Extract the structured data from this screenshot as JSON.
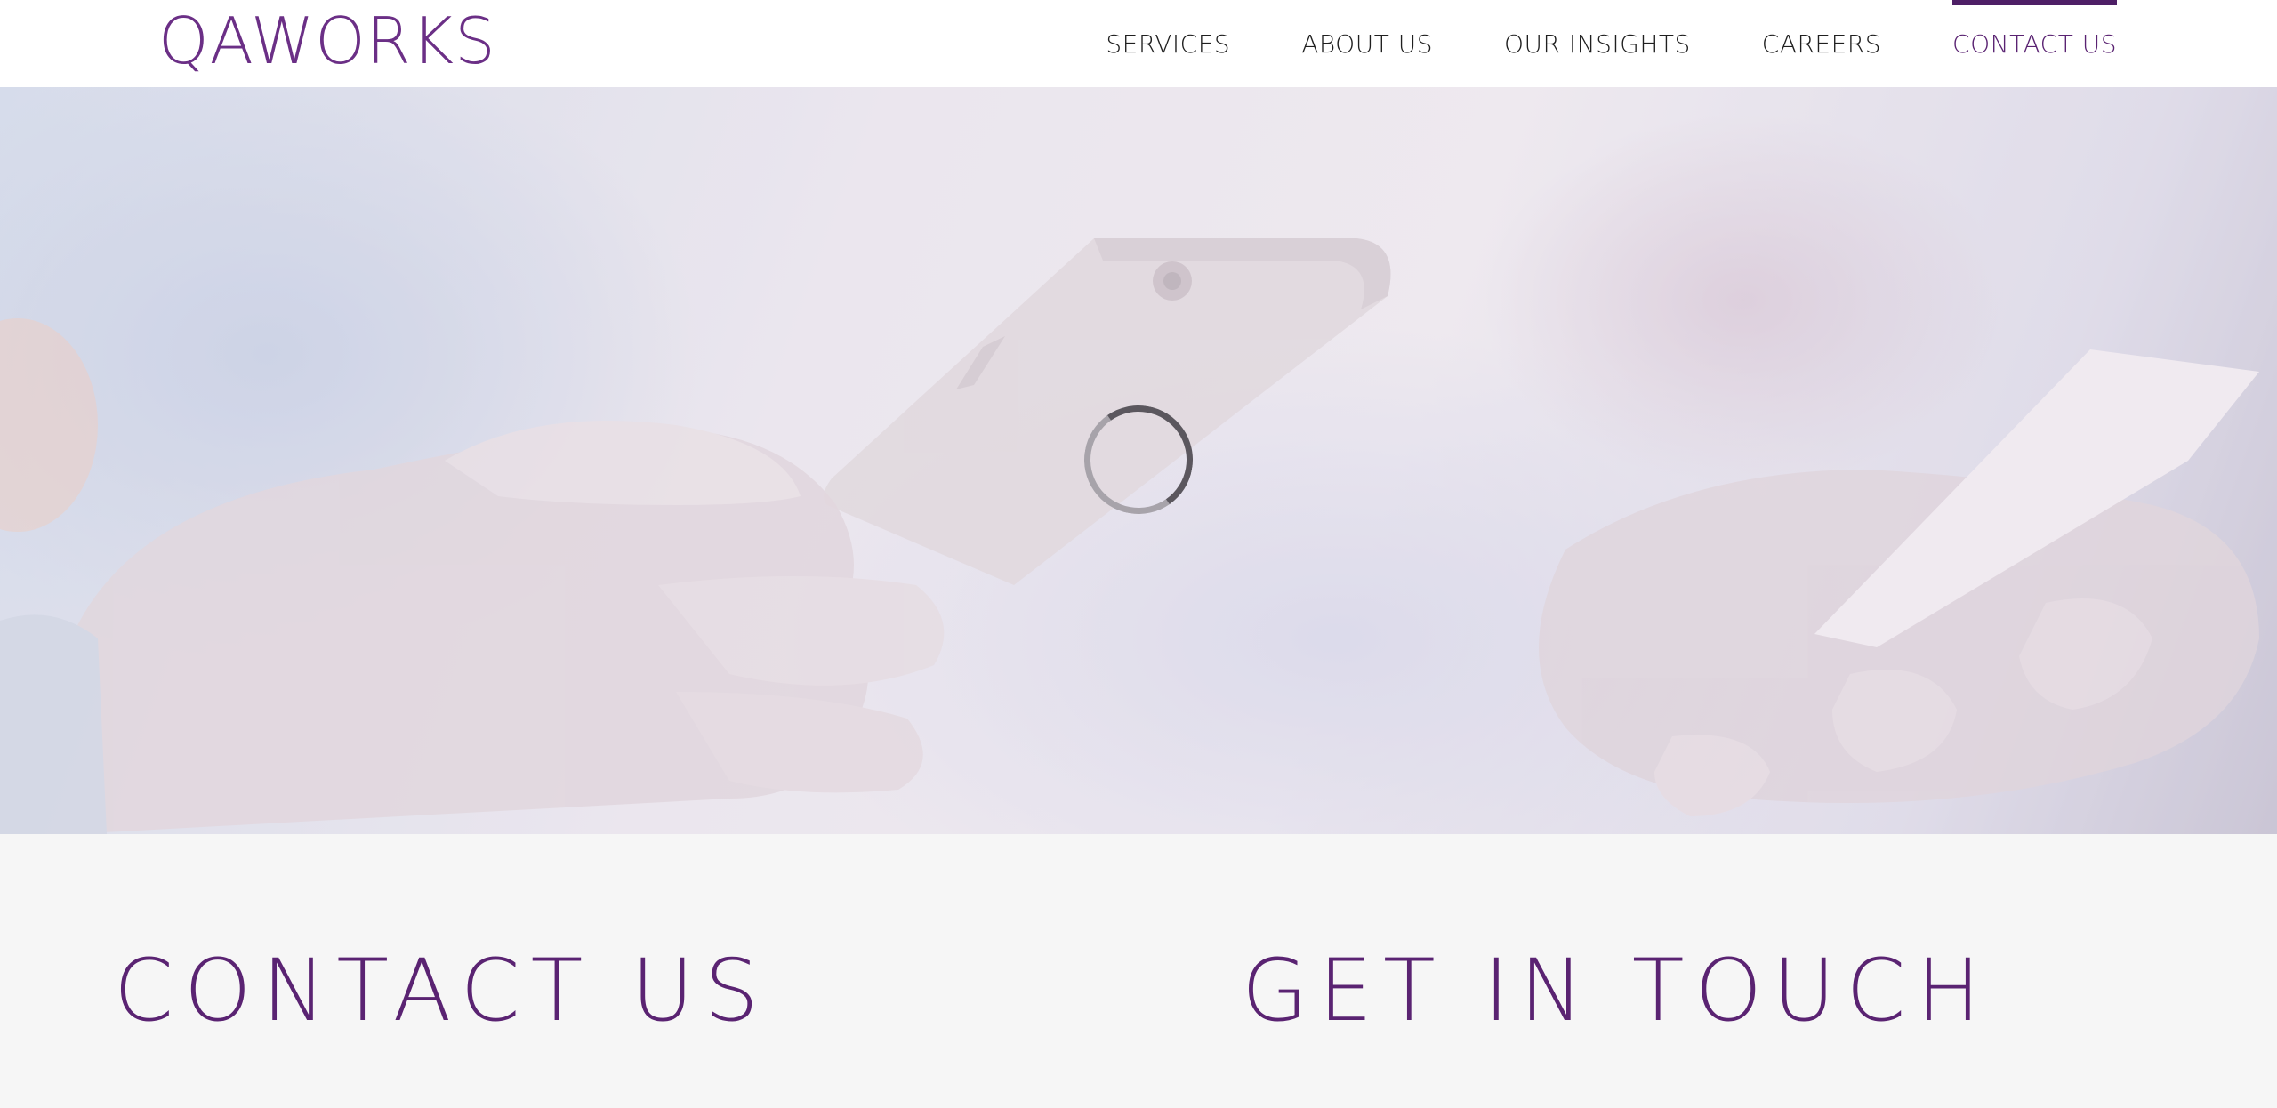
{
  "header": {
    "logo_text": "QAWORKS",
    "nav": [
      {
        "label": "SERVICES",
        "active": false
      },
      {
        "label": "ABOUT US",
        "active": false
      },
      {
        "label": "OUR INSIGHTS",
        "active": false
      },
      {
        "label": "CAREERS",
        "active": false
      },
      {
        "label": "CONTACT US",
        "active": true
      }
    ]
  },
  "hero": {
    "image_icon": "phone-and-card-photo",
    "loading_icon": "loading-spinner-icon"
  },
  "content": {
    "left_heading": "CONTACT US",
    "right_heading": "GET IN TOUCH"
  },
  "colors": {
    "brand": "#5a2372",
    "nav_active_bar": "#4e1f66",
    "nav_text": "#1f1f1f",
    "section_bg": "#f6f6f6"
  }
}
